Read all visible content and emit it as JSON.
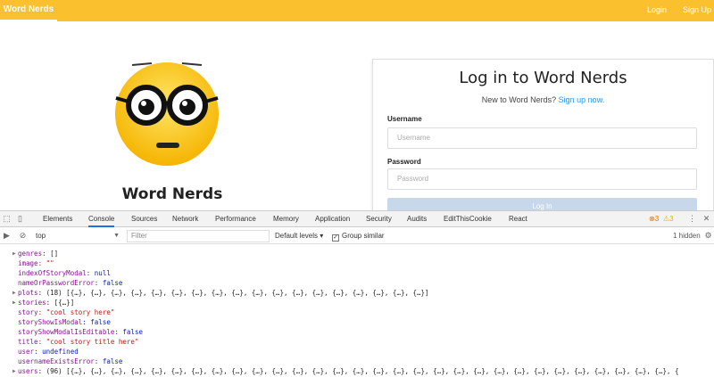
{
  "navbar": {
    "brand": "Word Nerds",
    "login": "Login",
    "signup": "Sign Up",
    "color": "#fbc02d"
  },
  "hero": {
    "site_title": "Word Nerds",
    "emoji_icon": "nerd-face-icon"
  },
  "login_card": {
    "title": "Log in to Word Nerds",
    "subtitle_prefix": "New to Word Nerds? ",
    "subtitle_link": "Sign up now.",
    "username_label": "Username",
    "username_placeholder": "Username",
    "password_label": "Password",
    "password_placeholder": "Password",
    "button": "Log In"
  },
  "devtools": {
    "tabs": [
      "Elements",
      "Console",
      "Sources",
      "Network",
      "Performance",
      "Memory",
      "Application",
      "Security",
      "Audits",
      "EditThisCookie",
      "React"
    ],
    "active_tab": "Console",
    "errors": "3",
    "warnings": "3",
    "context": "top",
    "filter_placeholder": "Filter",
    "levels": "Default levels",
    "group_similar": "Group similar",
    "hidden": "1 hidden",
    "lines": [
      {
        "expandable": true,
        "key": "genres",
        "rest": ": []"
      },
      {
        "expandable": false,
        "key": "image",
        "rest": ": \"\""
      },
      {
        "expandable": false,
        "key": "indexOfStoryModal",
        "rest": ": null"
      },
      {
        "expandable": false,
        "key": "nameOrPasswordError",
        "rest": ": false"
      },
      {
        "expandable": true,
        "key": "plots",
        "rest": ": (18) [{…}, {…}, {…}, {…}, {…}, {…}, {…}, {…}, {…}, {…}, {…}, {…}, {…}, {…}, {…}, {…}, {…}, {…}]"
      },
      {
        "expandable": true,
        "key": "stories",
        "rest": ": [{…}]"
      },
      {
        "expandable": false,
        "key": "story",
        "rest": ": \"cool story here\""
      },
      {
        "expandable": false,
        "key": "storyShowIsModal",
        "rest": ": false"
      },
      {
        "expandable": false,
        "key": "storyShowModalIsEditable",
        "rest": ": false"
      },
      {
        "expandable": false,
        "key": "title",
        "rest": ": \"cool story title here\""
      },
      {
        "expandable": false,
        "key": "user",
        "rest": ": undefined"
      },
      {
        "expandable": false,
        "key": "usernameExistsError",
        "rest": ": false"
      },
      {
        "expandable": true,
        "key": "users",
        "rest": ": (96) [{…}, {…}, {…}, {…}, {…}, {…}, {…}, {…}, {…}, {…}, {…}, {…}, {…}, {…}, {…}, {…}, {…}, {…}, {…}, {…}, {…}, {…}, {…}, {…}, {…}, {…}, {…}, {…}, {…}, {…}, {"
      }
    ]
  }
}
